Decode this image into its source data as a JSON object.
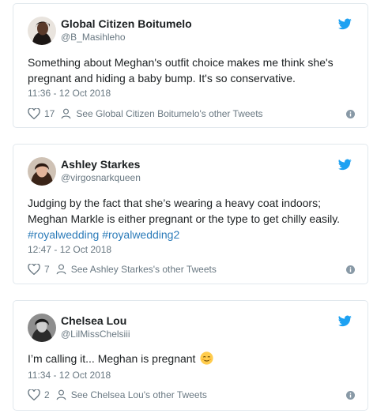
{
  "tweets": [
    {
      "name": "Global Citizen Boitumelo",
      "handle": "@B_Masihleho",
      "text": "Something about Meghan's outfit choice makes me think she's pregnant and hiding a baby bump. It's so conservative.",
      "timestamp": "11:36 - 12 Oct 2018",
      "likes": "17",
      "profile_link": "See Global Citizen Boitumelo's other Tweets"
    },
    {
      "name": "Ashley Starkes",
      "handle": "@virgosnarkqueen",
      "text": "Judging by the fact that she’s wearing a heavy coat indoors; Meghan Markle is either pregnant or the type to get chilly easily.",
      "hashtag_1": "#royalwedding",
      "hashtag_2": "#royalwedding2",
      "timestamp": "12:47 - 12 Oct 2018",
      "likes": "7",
      "profile_link": "See Ashley Starkes's other Tweets"
    },
    {
      "name": "Chelsea Lou",
      "handle": "@LilMissChelsiii",
      "text": "I’m calling it... Meghan is pregnant",
      "emoji": "relieved-face-emoji",
      "timestamp": "11:34 - 12 Oct 2018",
      "likes": "2",
      "profile_link": "See Chelsea Lou's other Tweets"
    }
  ],
  "colors": {
    "twitter_blue": "#1da1f2",
    "hashtag": "#2b7bb9",
    "muted": "#697882",
    "border": "#e1e8ed"
  }
}
